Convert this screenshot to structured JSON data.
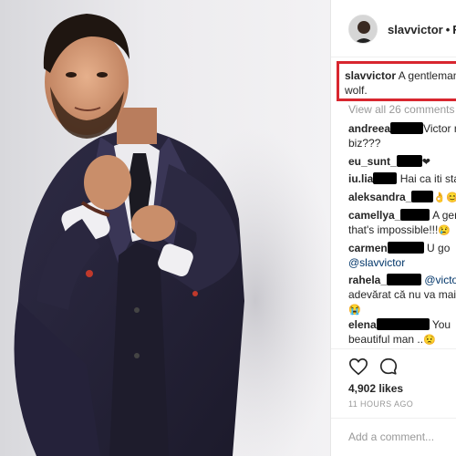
{
  "post": {
    "username": "slavvictor",
    "follow_label": "Fo",
    "caption_text": "A gentleman",
    "caption_text_line2": "wolf.",
    "view_all_comments": "View all 26 comments",
    "likes": "4,902 likes",
    "timestamp": "11 HOURS AGO",
    "add_comment_placeholder": "Add a comment..."
  },
  "comments": [
    {
      "user": "andreea",
      "line1": "Victor n",
      "line2": "biz???"
    },
    {
      "user": "eu_sunt_",
      "line1": "",
      "emoji": "❤"
    },
    {
      "user": "iu.lia",
      "line1": "Hai ca iti sta"
    },
    {
      "user": "aleksandra_",
      "line1": "",
      "emoji": "👌😊"
    },
    {
      "user": "camellya_",
      "line1": "A gent",
      "line2": "that's impossible!!!",
      "emoji2": "😢"
    },
    {
      "user": "carmen",
      "line1": "U go",
      "line2": "@slavvictor"
    },
    {
      "user": "rahela_",
      "line1": "@victors",
      "line2": "adevărat că nu va mai f",
      "emoji3": "😭"
    },
    {
      "user": "elena",
      "line1": "You",
      "line2": "beautiful man ..",
      "emoji2": "😟"
    }
  ],
  "icons": {
    "like": "heart-icon",
    "comment": "comment-bubble-icon",
    "avatar": "profile-avatar"
  },
  "colors": {
    "highlight_border": "#d8262f",
    "muted_text": "#999999",
    "mention": "#003569"
  }
}
